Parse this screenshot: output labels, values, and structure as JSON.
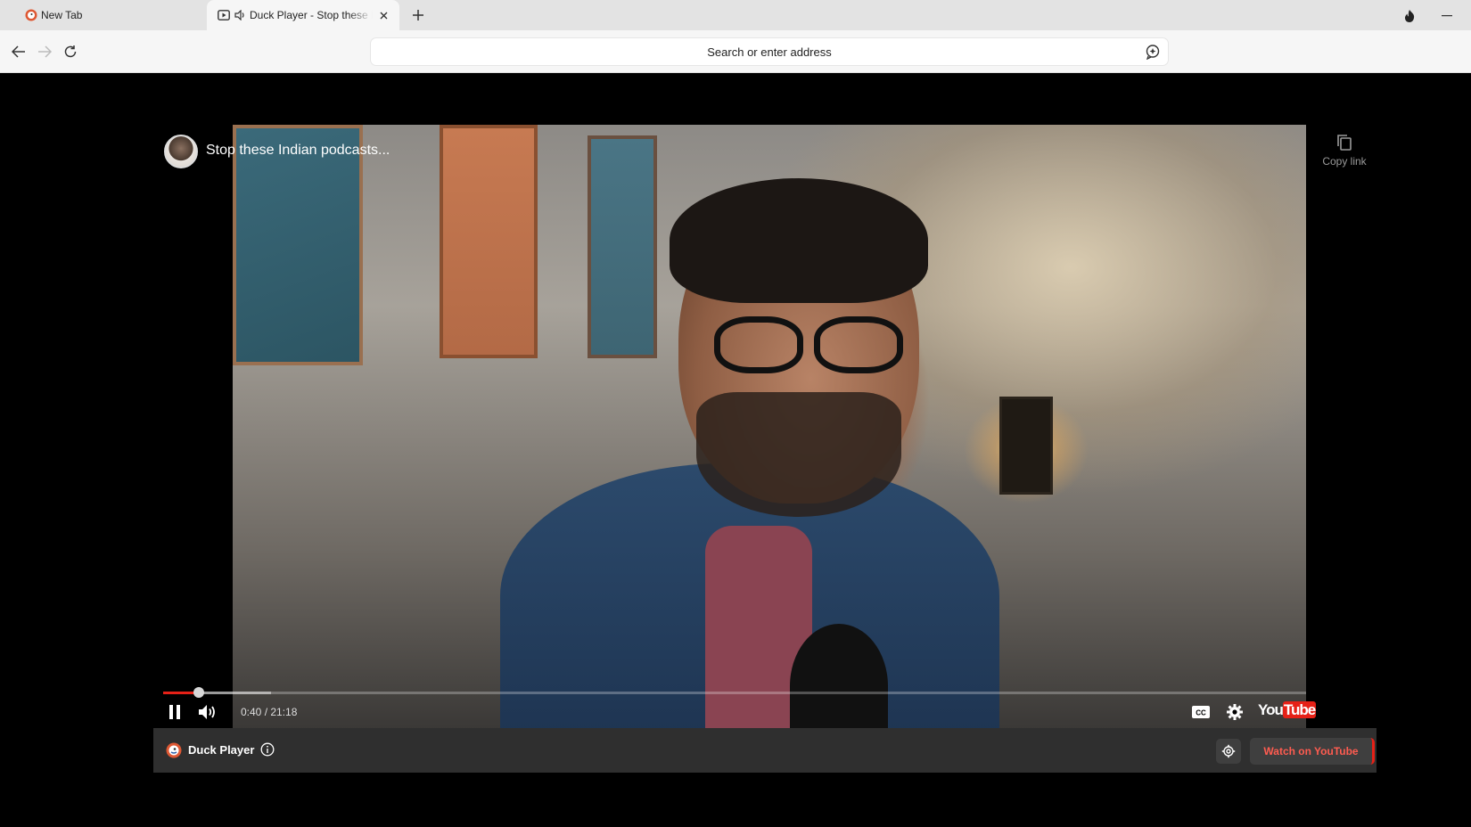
{
  "browser": {
    "tabs": [
      {
        "label": "New Tab",
        "icon": "duckduckgo-logo-icon"
      },
      {
        "label": "Duck Player - Stop these Indian podcasts...",
        "icon": "video-icon",
        "audio_icon": "speaker-icon",
        "active": true
      }
    ],
    "address_placeholder": "Search or enter address"
  },
  "video": {
    "title": "Stop these Indian podcasts...",
    "copy_link_label": "Copy link",
    "current_time": "0:40",
    "duration": "21:18",
    "time_display": "0:40 / 21:18",
    "played_fraction": 0.031,
    "buffered_fraction": 0.094,
    "youtube_logo": {
      "prefix": "You",
      "suffix": "Tube"
    }
  },
  "duck_player": {
    "label": "Duck Player",
    "watch_on_youtube_label": "Watch on YouTube"
  },
  "colors": {
    "accent_red": "#e62117",
    "duck_orange": "#de5833",
    "watch_text": "#ff5c50"
  }
}
